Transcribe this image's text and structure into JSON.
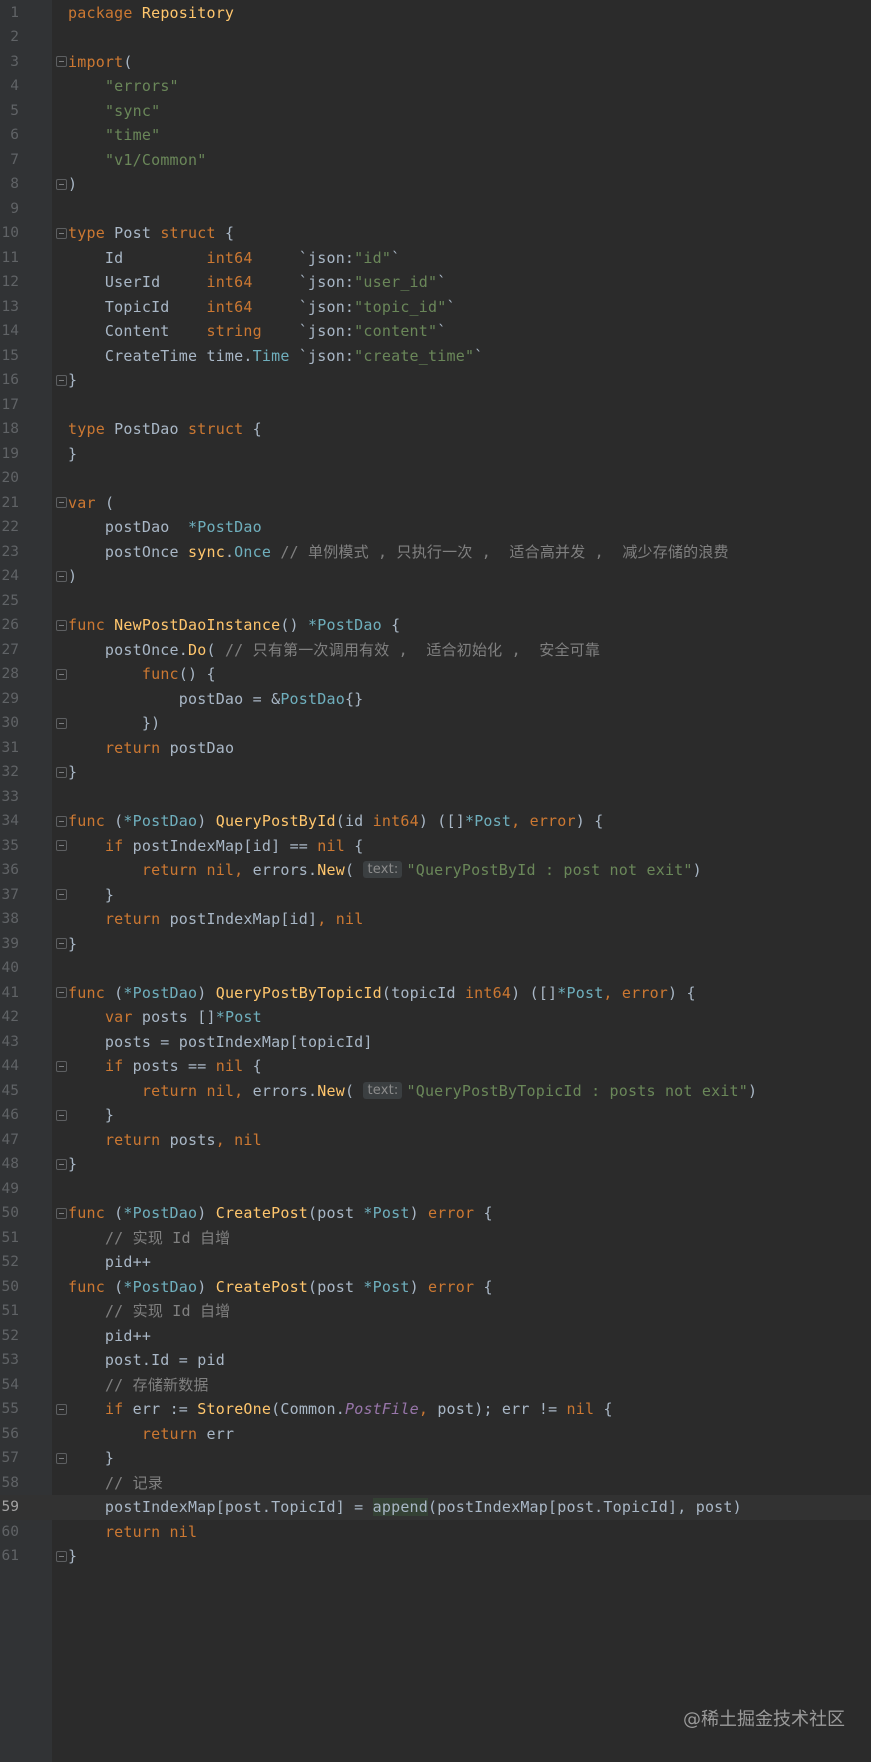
{
  "editor": {
    "watermark": "@稀土掘金技术社区",
    "lines": [
      {
        "n": "1",
        "segs": [
          [
            "kw",
            "package "
          ],
          [
            "fn",
            "Repository"
          ]
        ]
      },
      {
        "n": "2",
        "segs": []
      },
      {
        "n": "3",
        "segs": [
          [
            "kw",
            "import"
          ],
          [
            "",
            "("
          ]
        ],
        "fold": "open"
      },
      {
        "n": "4",
        "segs": [
          [
            "",
            "    "
          ],
          [
            "str",
            "\"errors\""
          ]
        ]
      },
      {
        "n": "5",
        "segs": [
          [
            "",
            "    "
          ],
          [
            "str",
            "\"sync\""
          ]
        ]
      },
      {
        "n": "6",
        "segs": [
          [
            "",
            "    "
          ],
          [
            "str",
            "\"time\""
          ]
        ]
      },
      {
        "n": "7",
        "segs": [
          [
            "",
            "    "
          ],
          [
            "str",
            "\"v1/Common\""
          ]
        ]
      },
      {
        "n": "8",
        "segs": [
          [
            "",
            ")"
          ]
        ],
        "fold": "close"
      },
      {
        "n": "9",
        "segs": []
      },
      {
        "n": "10",
        "segs": [
          [
            "kw",
            "type "
          ],
          [
            "",
            "Post "
          ],
          [
            "kw",
            "struct "
          ],
          [
            "",
            "{"
          ]
        ],
        "fold": "open"
      },
      {
        "n": "11",
        "segs": [
          [
            "",
            "    Id         "
          ],
          [
            "kw",
            "int64     "
          ],
          [
            "",
            "`json:"
          ],
          [
            "str",
            "\"id\""
          ],
          [
            "",
            "`"
          ]
        ]
      },
      {
        "n": "12",
        "segs": [
          [
            "",
            "    UserId     "
          ],
          [
            "kw",
            "int64     "
          ],
          [
            "",
            "`json:"
          ],
          [
            "str",
            "\"user_id\""
          ],
          [
            "",
            "`"
          ]
        ]
      },
      {
        "n": "13",
        "segs": [
          [
            "",
            "    TopicId    "
          ],
          [
            "kw",
            "int64     "
          ],
          [
            "",
            "`json:"
          ],
          [
            "str",
            "\"topic_id\""
          ],
          [
            "",
            "`"
          ]
        ]
      },
      {
        "n": "14",
        "segs": [
          [
            "",
            "    Content    "
          ],
          [
            "kw",
            "string    "
          ],
          [
            "",
            "`json:"
          ],
          [
            "str",
            "\"content\""
          ],
          [
            "",
            "`"
          ]
        ]
      },
      {
        "n": "15",
        "segs": [
          [
            "",
            "    CreateTime "
          ],
          [
            "",
            "time."
          ],
          [
            "ty",
            "Time "
          ],
          [
            "",
            "`json:"
          ],
          [
            "str",
            "\"create_time\""
          ],
          [
            "",
            "`"
          ]
        ]
      },
      {
        "n": "16",
        "segs": [
          [
            "",
            "}"
          ]
        ],
        "fold": "close"
      },
      {
        "n": "17",
        "segs": []
      },
      {
        "n": "18",
        "segs": [
          [
            "kw",
            "type "
          ],
          [
            "",
            "PostDao "
          ],
          [
            "kw",
            "struct "
          ],
          [
            "",
            "{"
          ]
        ]
      },
      {
        "n": "19",
        "segs": [
          [
            "",
            "}"
          ]
        ]
      },
      {
        "n": "20",
        "segs": []
      },
      {
        "n": "21",
        "segs": [
          [
            "kw",
            "var "
          ],
          [
            "",
            "("
          ]
        ],
        "fold": "open"
      },
      {
        "n": "22",
        "segs": [
          [
            "",
            "    postDao  "
          ],
          [
            "ty",
            "*PostDao"
          ]
        ]
      },
      {
        "n": "23",
        "segs": [
          [
            "",
            "    postOnce "
          ],
          [
            "fn",
            "sync"
          ],
          [
            "",
            "."
          ],
          [
            "ty",
            "Once "
          ],
          [
            "cm",
            "// 单例模式 , 只执行一次 ,  适合高并发 ,  减少存储的浪费"
          ]
        ]
      },
      {
        "n": "24",
        "segs": [
          [
            "",
            ")"
          ]
        ],
        "fold": "close"
      },
      {
        "n": "25",
        "segs": []
      },
      {
        "n": "26",
        "segs": [
          [
            "kw",
            "func "
          ],
          [
            "fn",
            "NewPostDaoInstance"
          ],
          [
            "",
            "() "
          ],
          [
            "ty",
            "*PostDao "
          ],
          [
            "",
            "{"
          ]
        ],
        "fold": "open"
      },
      {
        "n": "27",
        "segs": [
          [
            "",
            "    postOnce."
          ],
          [
            "fn",
            "Do"
          ],
          [
            "",
            "( "
          ],
          [
            "cm",
            "// 只有第一次调用有效 ,  适合初始化 ,  安全可靠"
          ]
        ]
      },
      {
        "n": "28",
        "segs": [
          [
            "",
            "        "
          ],
          [
            "kw",
            "func"
          ],
          [
            "",
            "() {"
          ]
        ],
        "fold": "open"
      },
      {
        "n": "29",
        "segs": [
          [
            "",
            "            postDao = &"
          ],
          [
            "ty",
            "PostDao"
          ],
          [
            "",
            "{}"
          ]
        ]
      },
      {
        "n": "30",
        "segs": [
          [
            "",
            "        })"
          ]
        ],
        "fold": "close"
      },
      {
        "n": "31",
        "segs": [
          [
            "",
            "    "
          ],
          [
            "kw",
            "return "
          ],
          [
            "",
            "postDao"
          ]
        ]
      },
      {
        "n": "32",
        "segs": [
          [
            "",
            "}"
          ]
        ],
        "fold": "close"
      },
      {
        "n": "33",
        "segs": []
      },
      {
        "n": "34",
        "segs": [
          [
            "kw",
            "func "
          ],
          [
            "",
            "("
          ],
          [
            "ty",
            "*PostDao"
          ],
          [
            "",
            ") "
          ],
          [
            "fn",
            "QueryPostById"
          ],
          [
            "",
            "(id "
          ],
          [
            "kw",
            "int64"
          ],
          [
            "",
            ") ([]"
          ],
          [
            "ty",
            "*Post"
          ],
          [
            "kw",
            ", error"
          ],
          [
            "",
            ") {"
          ]
        ],
        "fold": "open"
      },
      {
        "n": "35",
        "segs": [
          [
            "",
            "    "
          ],
          [
            "kw",
            "if "
          ],
          [
            "",
            "postIndexMap[id] == "
          ],
          [
            "kw",
            "nil "
          ],
          [
            "",
            "{"
          ]
        ],
        "fold": "open"
      },
      {
        "n": "36",
        "segs": [
          [
            "",
            "        "
          ],
          [
            "kw",
            "return nil, "
          ],
          [
            "",
            "errors."
          ],
          [
            "fn",
            "New"
          ],
          [
            "",
            "( "
          ],
          [
            "hint",
            "text:"
          ],
          [
            "str",
            "\"QueryPostById : post not exit\""
          ],
          [
            "",
            ")"
          ]
        ]
      },
      {
        "n": "37",
        "segs": [
          [
            "",
            "    }"
          ]
        ],
        "fold": "close"
      },
      {
        "n": "38",
        "segs": [
          [
            "",
            "    "
          ],
          [
            "kw",
            "return "
          ],
          [
            "",
            "postIndexMap[id]"
          ],
          [
            "kw",
            ", nil"
          ]
        ]
      },
      {
        "n": "39",
        "segs": [
          [
            "",
            "}"
          ]
        ],
        "fold": "close"
      },
      {
        "n": "40",
        "segs": []
      },
      {
        "n": "41",
        "segs": [
          [
            "kw",
            "func "
          ],
          [
            "",
            "("
          ],
          [
            "ty",
            "*PostDao"
          ],
          [
            "",
            ") "
          ],
          [
            "fn",
            "QueryPostByTopicId"
          ],
          [
            "",
            "(topicId "
          ],
          [
            "kw",
            "int64"
          ],
          [
            "",
            ") ([]"
          ],
          [
            "ty",
            "*Post"
          ],
          [
            "kw",
            ", error"
          ],
          [
            "",
            ") {"
          ]
        ],
        "fold": "open"
      },
      {
        "n": "42",
        "segs": [
          [
            "",
            "    "
          ],
          [
            "kw",
            "var "
          ],
          [
            "",
            "posts []"
          ],
          [
            "ty",
            "*Post"
          ]
        ]
      },
      {
        "n": "43",
        "segs": [
          [
            "",
            "    posts = postIndexMap[topicId]"
          ]
        ]
      },
      {
        "n": "44",
        "segs": [
          [
            "",
            "    "
          ],
          [
            "kw",
            "if "
          ],
          [
            "",
            "posts == "
          ],
          [
            "kw",
            "nil "
          ],
          [
            "",
            "{"
          ]
        ],
        "fold": "open"
      },
      {
        "n": "45",
        "segs": [
          [
            "",
            "        "
          ],
          [
            "kw",
            "return nil, "
          ],
          [
            "",
            "errors."
          ],
          [
            "fn",
            "New"
          ],
          [
            "",
            "( "
          ],
          [
            "hint",
            "text:"
          ],
          [
            "str",
            "\"QueryPostByTopicId : posts not exit\""
          ],
          [
            "",
            ")"
          ]
        ]
      },
      {
        "n": "46",
        "segs": [
          [
            "",
            "    }"
          ]
        ],
        "fold": "close"
      },
      {
        "n": "47",
        "segs": [
          [
            "",
            "    "
          ],
          [
            "kw",
            "return "
          ],
          [
            "",
            "posts"
          ],
          [
            "kw",
            ", nil"
          ]
        ]
      },
      {
        "n": "48",
        "segs": [
          [
            "",
            "}"
          ]
        ],
        "fold": "close"
      },
      {
        "n": "49",
        "segs": []
      },
      {
        "n": "50",
        "segs": [
          [
            "kw",
            "func "
          ],
          [
            "",
            "("
          ],
          [
            "ty",
            "*PostDao"
          ],
          [
            "",
            ") "
          ],
          [
            "fn",
            "CreatePost"
          ],
          [
            "",
            "(post "
          ],
          [
            "ty",
            "*Post"
          ],
          [
            "",
            ") "
          ],
          [
            "kw",
            "error "
          ],
          [
            "",
            "{"
          ]
        ],
        "fold": "open"
      },
      {
        "n": "51",
        "segs": [
          [
            "",
            "    "
          ],
          [
            "cm",
            "// 实现 Id 自增"
          ]
        ]
      },
      {
        "n": "52",
        "segs": [
          [
            "",
            "    pid++"
          ]
        ]
      },
      {
        "n": "50",
        "segs": [
          [
            "kw",
            "func "
          ],
          [
            "",
            "("
          ],
          [
            "ty",
            "*PostDao"
          ],
          [
            "",
            ") "
          ],
          [
            "fn",
            "CreatePost"
          ],
          [
            "",
            "(post "
          ],
          [
            "ty",
            "*Post"
          ],
          [
            "",
            ") "
          ],
          [
            "kw",
            "error "
          ],
          [
            "",
            "{"
          ]
        ],
        "cut": true
      },
      {
        "n": "51",
        "segs": [
          [
            "",
            "    "
          ],
          [
            "cm",
            "// 实现 Id 自增"
          ]
        ]
      },
      {
        "n": "52",
        "segs": [
          [
            "",
            "    pid++"
          ]
        ]
      },
      {
        "n": "53",
        "segs": [
          [
            "",
            "    post.Id = pid"
          ]
        ]
      },
      {
        "n": "54",
        "segs": [
          [
            "",
            "    "
          ],
          [
            "cm",
            "// 存储新数据"
          ]
        ]
      },
      {
        "n": "55",
        "segs": [
          [
            "",
            "    "
          ],
          [
            "kw",
            "if "
          ],
          [
            "",
            "err := "
          ],
          [
            "fn",
            "StoreOne"
          ],
          [
            "",
            "(Common."
          ],
          [
            "gl",
            "PostFile"
          ],
          [
            "kw",
            ", "
          ],
          [
            "",
            "post); err != "
          ],
          [
            "kw",
            "nil "
          ],
          [
            "",
            "{"
          ]
        ],
        "fold": "open"
      },
      {
        "n": "56",
        "segs": [
          [
            "",
            "        "
          ],
          [
            "kw",
            "return "
          ],
          [
            "",
            "err"
          ]
        ]
      },
      {
        "n": "57",
        "segs": [
          [
            "",
            "    }"
          ]
        ],
        "fold": "close"
      },
      {
        "n": "58",
        "segs": [
          [
            "",
            "    "
          ],
          [
            "cm",
            "// 记录"
          ]
        ]
      },
      {
        "n": "59",
        "segs": [
          [
            "",
            "    postIndexMap[post.TopicId] = "
          ],
          [
            "hl",
            "append"
          ],
          [
            "",
            "(postIndexMap[post.TopicId], post)"
          ]
        ],
        "current": true
      },
      {
        "n": "60",
        "segs": [
          [
            "",
            "    "
          ],
          [
            "kw",
            "return nil"
          ]
        ]
      },
      {
        "n": "61",
        "segs": [
          [
            "",
            "}"
          ]
        ],
        "fold": "close"
      }
    ]
  }
}
